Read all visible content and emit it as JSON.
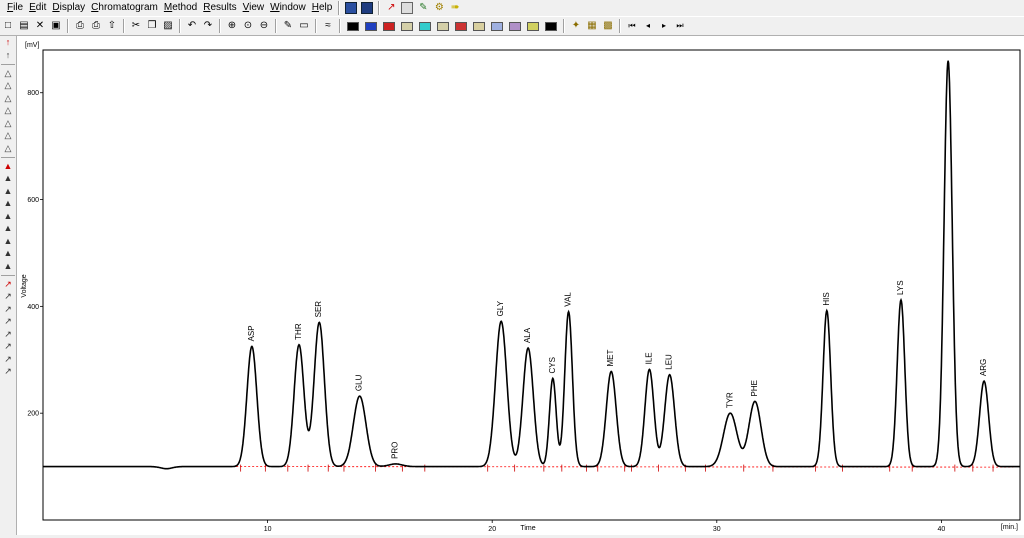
{
  "menu": [
    {
      "label": "File"
    },
    {
      "label": "Edit"
    },
    {
      "label": "Display"
    },
    {
      "label": "Chromatogram"
    },
    {
      "label": "Method"
    },
    {
      "label": "Results"
    },
    {
      "label": "View"
    },
    {
      "label": "Window"
    },
    {
      "label": "Help"
    }
  ],
  "toolbar": {
    "icons": [
      "new-icon",
      "open-icon",
      "close-icon",
      "save-icon",
      "print-icon",
      "print-preview-icon",
      "export-icon",
      "cut-icon",
      "copy-icon",
      "paste-icon",
      "undo-icon",
      "redo-icon",
      "zoom-in-icon",
      "zoom-reset-icon",
      "zoom-out-icon",
      "edit-icon",
      "comment-icon",
      "calibration-icon"
    ],
    "swatch_colors": [
      "#000000",
      "#1f3fbf",
      "#cc2222",
      "#d4cfa8",
      "#33cccc",
      "#d4cfa8",
      "#cc3333",
      "#d9d0a0",
      "#9fb0e0",
      "#b090c8",
      "#d0d060",
      "#000000"
    ],
    "nav_icons": [
      "first-icon",
      "previous-icon",
      "next-icon",
      "last-icon"
    ]
  },
  "sidebar": {
    "icons": [
      "peak-icon",
      "peak-icon",
      "integration-icon",
      "integration-icon",
      "integration-icon",
      "integration-icon",
      "integration-icon",
      "integration-icon",
      "integration-icon",
      "peak-edit-icon",
      "peak-edit-icon",
      "peak-edit-icon",
      "peak-edit-icon",
      "peak-edit-icon",
      "peak-edit-icon",
      "peak-edit-icon",
      "peak-edit-icon",
      "peak-edit-icon",
      "baseline-icon",
      "baseline-icon",
      "baseline-icon",
      "baseline-icon",
      "baseline-icon",
      "baseline-icon",
      "baseline-icon",
      "baseline-icon"
    ]
  },
  "chart_data": {
    "type": "line",
    "xlabel": "Time",
    "x_unit": "[min.]",
    "ylabel": "Voltage",
    "y_unit": "[mV]",
    "xlim": [
      0.0,
      43.5
    ],
    "ylim": [
      0,
      880
    ],
    "xticks": [
      10,
      20,
      30,
      40
    ],
    "yticks": [
      200,
      400,
      600,
      800
    ],
    "baseline": 100,
    "line_color": "#000000",
    "baseline_color": "#ff0000",
    "peaks": [
      {
        "name": "ASP",
        "rt": 9.3,
        "height": 325,
        "width": 0.22
      },
      {
        "name": "THR",
        "rt": 11.4,
        "height": 328,
        "width": 0.22
      },
      {
        "name": "SER",
        "rt": 12.3,
        "height": 370,
        "width": 0.23
      },
      {
        "name": "GLU",
        "rt": 14.1,
        "height": 232,
        "width": 0.28
      },
      {
        "name": "PRO",
        "rt": 15.7,
        "height": 105,
        "width": 0.3
      },
      {
        "name": "GLY",
        "rt": 20.4,
        "height": 372,
        "width": 0.25
      },
      {
        "name": "ALA",
        "rt": 21.6,
        "height": 322,
        "width": 0.23
      },
      {
        "name": "CYS",
        "rt": 22.7,
        "height": 265,
        "width": 0.15
      },
      {
        "name": "VAL",
        "rt": 23.4,
        "height": 390,
        "width": 0.17
      },
      {
        "name": "MET",
        "rt": 25.3,
        "height": 278,
        "width": 0.22
      },
      {
        "name": "ILE",
        "rt": 27.0,
        "height": 282,
        "width": 0.2
      },
      {
        "name": "LEU",
        "rt": 27.9,
        "height": 272,
        "width": 0.22
      },
      {
        "name": "TYR",
        "rt": 30.6,
        "height": 200,
        "width": 0.3
      },
      {
        "name": "PHE",
        "rt": 31.7,
        "height": 222,
        "width": 0.27
      },
      {
        "name": "HIS",
        "rt": 34.9,
        "height": 392,
        "width": 0.17
      },
      {
        "name": "LYS",
        "rt": 38.2,
        "height": 412,
        "width": 0.17
      },
      {
        "name": null,
        "rt": 40.3,
        "height": 860,
        "width": 0.18
      },
      {
        "name": "ARG",
        "rt": 41.9,
        "height": 260,
        "width": 0.2
      }
    ],
    "markers": [
      8.8,
      9.9,
      10.9,
      11.8,
      12.7,
      13.4,
      14.8,
      16.0,
      17.0,
      19.8,
      21.0,
      22.3,
      23.1,
      24.2,
      24.7,
      25.9,
      26.2,
      27.4,
      28.6,
      29.5,
      31.2,
      32.5,
      34.4,
      35.6,
      37.7,
      38.7,
      40.6,
      41.4,
      42.3
    ],
    "grid": false,
    "legend": false
  }
}
